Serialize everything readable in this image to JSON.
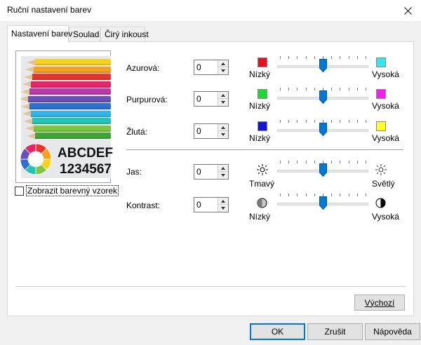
{
  "window": {
    "title": "Ruční nastavení barev",
    "close_icon": "close-icon"
  },
  "tabs": [
    {
      "label": "Nastavení barev",
      "active": true
    },
    {
      "label": "Soulad",
      "active": false
    },
    {
      "label": "Čirý inkoust",
      "active": false
    }
  ],
  "preview": {
    "sample_line1": "ABCDEF",
    "sample_line2": "1234567",
    "show_sample_label": "Zobrazit barevný vzorek",
    "show_sample_checked": false
  },
  "color_rows": [
    {
      "label": "Azurová:",
      "value": "0",
      "low_label": "Nízký",
      "high_label": "Vysoká",
      "low_color": "#e81123",
      "high_color": "#33e6f0",
      "level": 0.5
    },
    {
      "label": "Purpurová:",
      "value": "0",
      "low_label": "Nízký",
      "high_label": "Vysoká",
      "low_color": "#22d639",
      "high_color": "#ee22ee",
      "level": 0.5
    },
    {
      "label": "Žlutá:",
      "value": "0",
      "low_label": "Nízký",
      "high_label": "Vysoká",
      "low_color": "#1515d8",
      "high_color": "#ffff26",
      "level": 0.5
    }
  ],
  "brightness": {
    "label": "Jas:",
    "value": "0",
    "low_label": "Tmavý",
    "high_label": "Světlý",
    "low_icon": "sun-dark-icon",
    "high_icon": "sun-light-icon",
    "level": 0.5
  },
  "contrast": {
    "label": "Kontrast:",
    "value": "0",
    "low_label": "Nízký",
    "high_label": "Vysoká",
    "low_icon": "contrast-low-icon",
    "high_icon": "contrast-high-icon",
    "level": 0.5
  },
  "buttons": {
    "default_label": "Výchozí",
    "ok_label": "OK",
    "cancel_label": "Zrušit",
    "help_label": "Nápověda"
  },
  "colors": {
    "accent": "#0078d7",
    "dialog_bg": "#f0f0f0"
  }
}
